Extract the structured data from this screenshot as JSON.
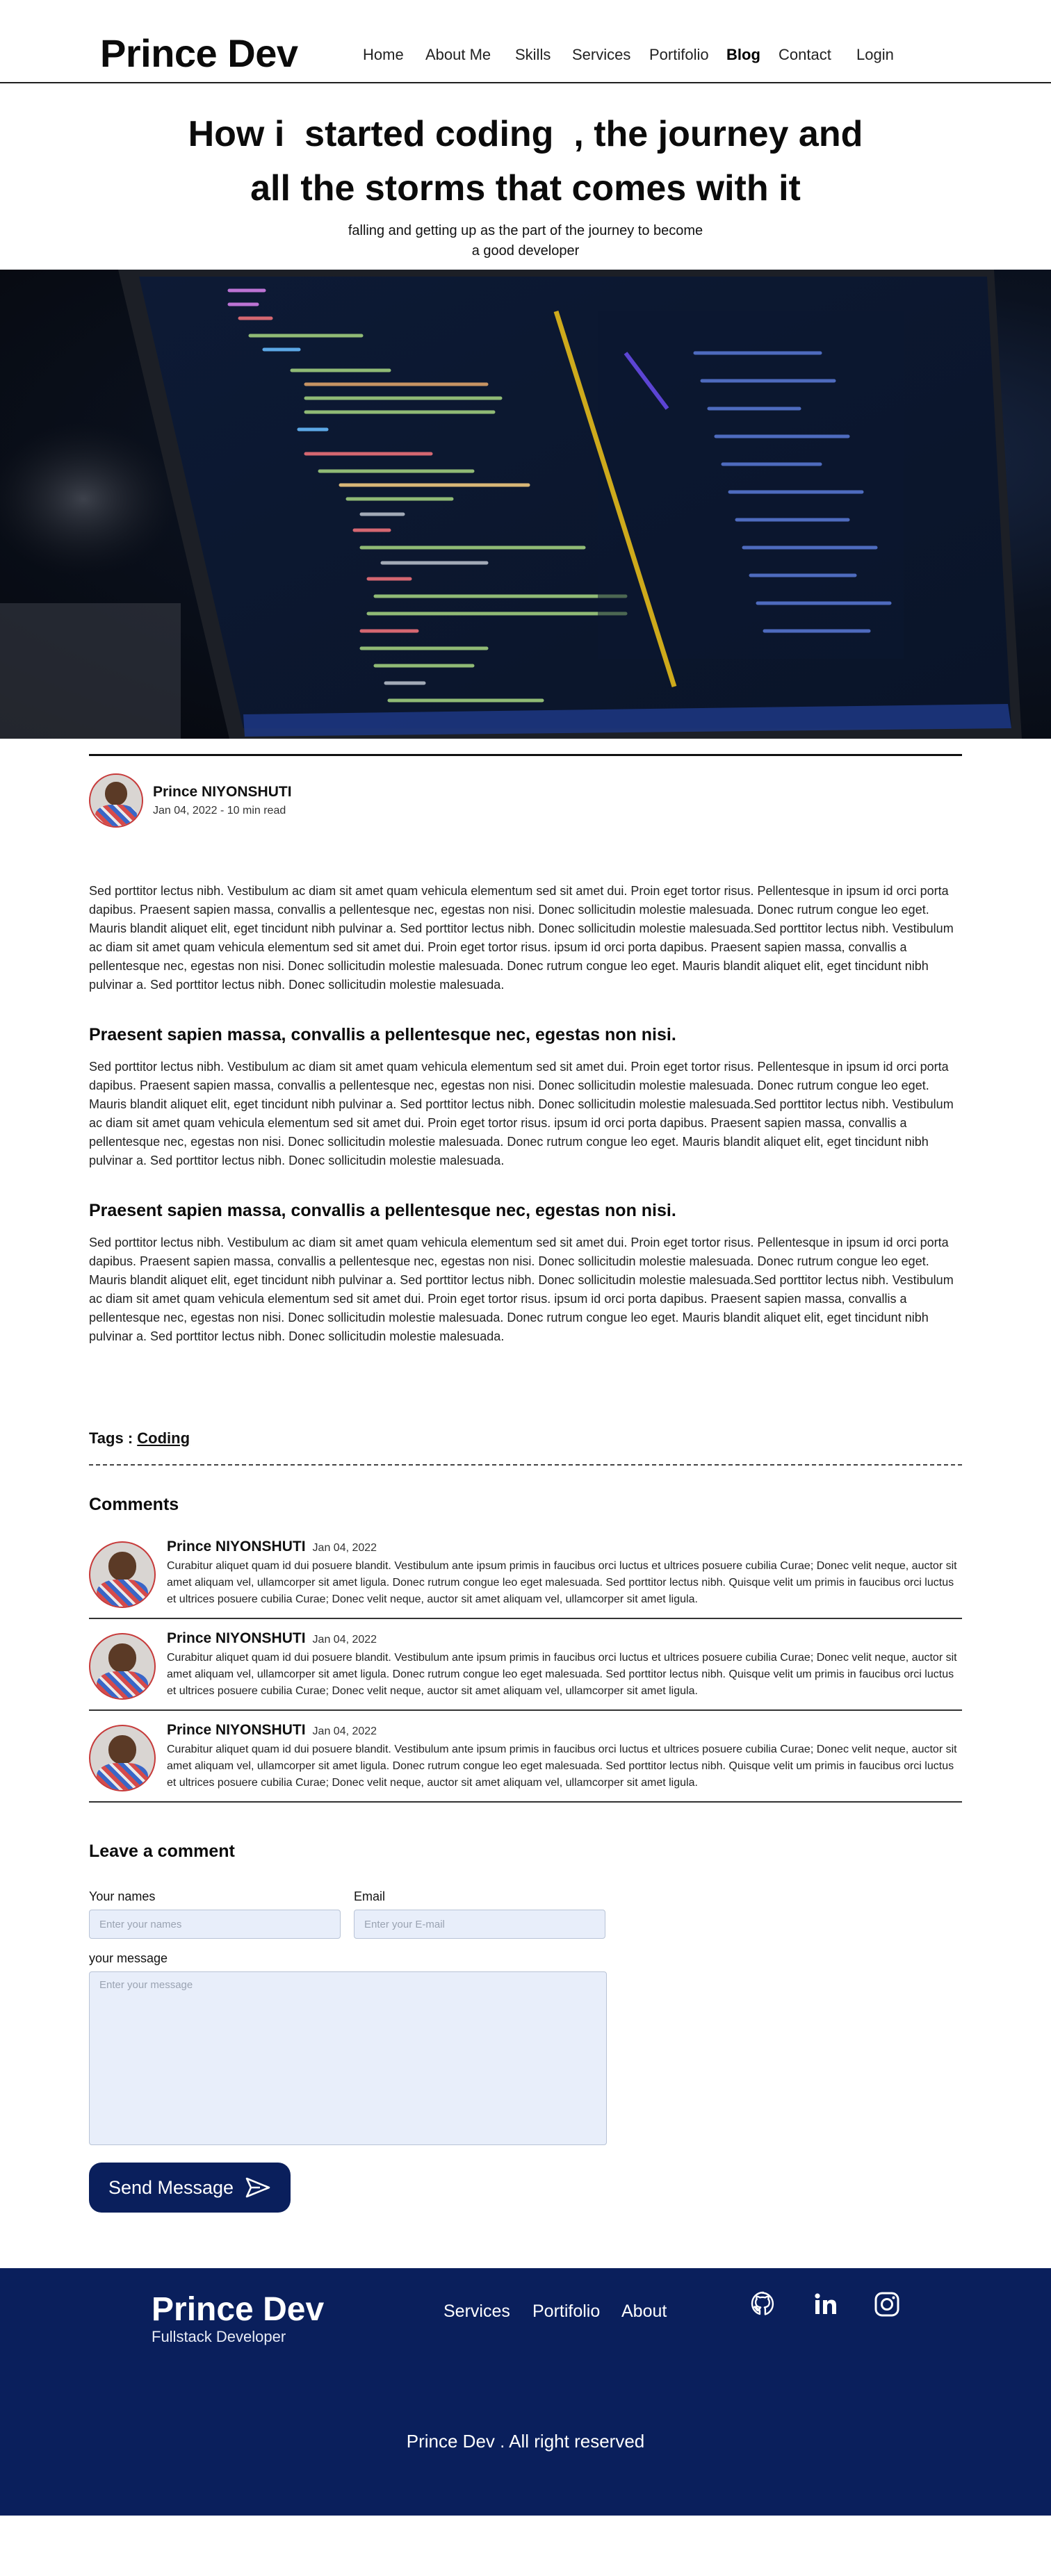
{
  "header": {
    "brand": "Prince Dev",
    "nav": [
      {
        "label": "Home",
        "active": false
      },
      {
        "label": "About Me",
        "active": false
      },
      {
        "label": "Skills",
        "active": false
      },
      {
        "label": "Services",
        "active": false
      },
      {
        "label": "Portifolio",
        "active": false
      },
      {
        "label": "Blog",
        "active": true
      },
      {
        "label": "Contact",
        "active": false
      },
      {
        "label": "Login",
        "active": false
      }
    ]
  },
  "hero": {
    "title_line1": "How i  started coding  , the journey and",
    "title_line2": "all the storms that comes with it",
    "subtitle_line1": "falling and getting up as the part of the journey to become",
    "subtitle_line2": "a good developer"
  },
  "banner": {
    "icon": "code-laptop-image"
  },
  "article": {
    "author": {
      "name": "Prince NIYONSHUTI",
      "meta": "Jan 04, 2022 - 10 min read"
    },
    "intro": "Sed porttitor lectus nibh. Vestibulum ac diam sit amet quam vehicula elementum sed sit amet dui. Proin eget tortor risus. Pellentesque in ipsum id orci porta dapibus. Praesent sapien massa, convallis a pellentesque nec, egestas non nisi. Donec sollicitudin molestie malesuada. Donec rutrum congue leo eget. Mauris blandit aliquet elit, eget tincidunt nibh pulvinar a. Sed porttitor lectus nibh. Donec sollicitudin molestie malesuada.Sed porttitor lectus nibh. Vestibulum ac diam sit amet quam vehicula elementum sed sit amet dui. Proin eget tortor risus. ipsum id orci porta dapibus. Praesent sapien massa, convallis a pellentesque nec, egestas non nisi. Donec sollicitudin molestie malesuada. Donec rutrum congue leo eget. Mauris blandit aliquet elit, eget tincidunt nibh pulvinar a. Sed porttitor lectus nibh. Donec sollicitudin molestie malesuada.",
    "sections": [
      {
        "title": "Praesent sapien massa, convallis a pellentesque nec, egestas non nisi.",
        "body": "Sed porttitor lectus nibh. Vestibulum ac diam sit amet quam vehicula elementum sed sit amet dui. Proin eget tortor risus. Pellentesque in ipsum id orci porta dapibus. Praesent sapien massa, convallis a pellentesque nec, egestas non nisi. Donec sollicitudin molestie malesuada. Donec rutrum congue leo eget. Mauris blandit aliquet elit, eget tincidunt nibh pulvinar a. Sed porttitor lectus nibh. Donec sollicitudin molestie malesuada.Sed porttitor lectus nibh. Vestibulum ac diam sit amet quam vehicula elementum sed sit amet dui. Proin eget tortor risus. ipsum id orci porta dapibus. Praesent sapien massa, convallis a pellentesque nec, egestas non nisi. Donec sollicitudin molestie malesuada. Donec rutrum congue leo eget. Mauris blandit aliquet elit, eget tincidunt nibh pulvinar a. Sed porttitor lectus nibh. Donec sollicitudin molestie malesuada."
      },
      {
        "title": "Praesent sapien massa, convallis a pellentesque nec, egestas non nisi.",
        "body": "Sed porttitor lectus nibh. Vestibulum ac diam sit amet quam vehicula elementum sed sit amet dui. Proin eget tortor risus. Pellentesque in ipsum id orci porta dapibus. Praesent sapien massa, convallis a pellentesque nec, egestas non nisi. Donec sollicitudin molestie malesuada. Donec rutrum congue leo eget. Mauris blandit aliquet elit, eget tincidunt nibh pulvinar a. Sed porttitor lectus nibh. Donec sollicitudin molestie malesuada.Sed porttitor lectus nibh. Vestibulum ac diam sit amet quam vehicula elementum sed sit amet dui. Proin eget tortor risus. ipsum id orci porta dapibus. Praesent sapien massa, convallis a pellentesque nec, egestas non nisi. Donec sollicitudin molestie malesuada. Donec rutrum congue leo eget. Mauris blandit aliquet elit, eget tincidunt nibh pulvinar a. Sed porttitor lectus nibh. Donec sollicitudin molestie malesuada."
      }
    ],
    "tags_label": "Tags : ",
    "tags": [
      "Coding"
    ]
  },
  "comments": {
    "title": "Comments",
    "items": [
      {
        "name": "Prince NIYONSHUTI",
        "date": "Jan 04, 2022",
        "text": "Curabitur aliquet quam id dui posuere blandit. Vestibulum ante ipsum primis in faucibus orci luctus et ultrices posuere cubilia Curae; Donec velit neque, auctor sit amet aliquam vel, ullamcorper sit amet ligula. Donec rutrum congue leo eget malesuada. Sed porttitor lectus nibh. Quisque velit um primis in faucibus orci luctus et ultrices posuere cubilia Curae; Donec velit neque, auctor sit amet aliquam vel, ullamcorper sit amet ligula."
      },
      {
        "name": "Prince NIYONSHUTI",
        "date": "Jan 04, 2022",
        "text": "Curabitur aliquet quam id dui posuere blandit. Vestibulum ante ipsum primis in faucibus orci luctus et ultrices posuere cubilia Curae; Donec velit neque, auctor sit amet aliquam vel, ullamcorper sit amet ligula. Donec rutrum congue leo eget malesuada. Sed porttitor lectus nibh. Quisque velit um primis in faucibus orci luctus et ultrices posuere cubilia Curae; Donec velit neque, auctor sit amet aliquam vel, ullamcorper sit amet ligula."
      },
      {
        "name": "Prince NIYONSHUTI",
        "date": "Jan 04, 2022",
        "text": "Curabitur aliquet quam id dui posuere blandit. Vestibulum ante ipsum primis in faucibus orci luctus et ultrices posuere cubilia Curae; Donec velit neque, auctor sit amet aliquam vel, ullamcorper sit amet ligula. Donec rutrum congue leo eget malesuada. Sed porttitor lectus nibh. Quisque velit um primis in faucibus orci luctus et ultrices posuere cubilia Curae; Donec velit neque, auctor sit amet aliquam vel, ullamcorper sit amet ligula."
      }
    ]
  },
  "form": {
    "title": "Leave a comment",
    "name_label": "Your names",
    "name_placeholder": "Enter your names",
    "email_label": "Email",
    "email_placeholder": "Enter your E-mail",
    "message_label": "your message",
    "message_placeholder": "Enter your message",
    "send_label": "Send Message",
    "send_icon": "send-icon"
  },
  "footer": {
    "brand": "Prince Dev",
    "subtitle": "Fullstack Developer",
    "links": [
      "Services",
      "Portifolio",
      "About"
    ],
    "social": [
      "github-icon",
      "linkedin-icon",
      "instagram-icon"
    ],
    "copyright": "Prince Dev . All right reserved",
    "bg_color": "#0a1f5c"
  }
}
